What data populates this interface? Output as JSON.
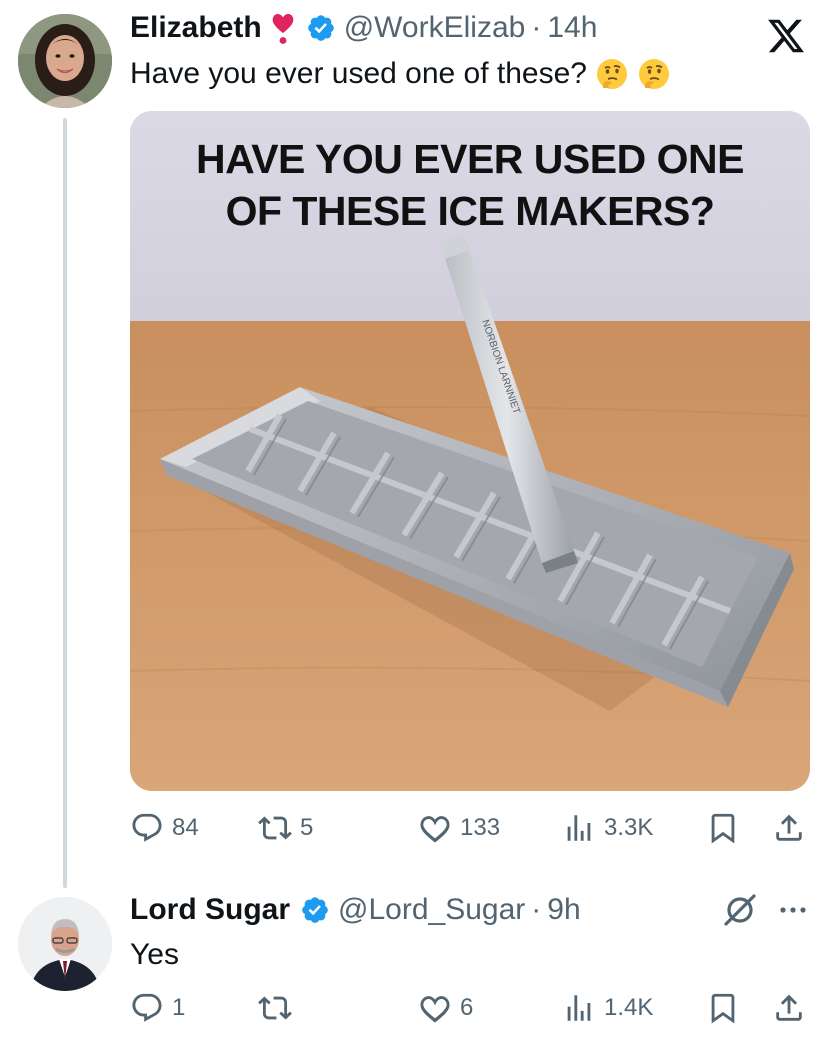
{
  "tweet": {
    "display_name": "Elizabeth",
    "handle": "@WorkElizab",
    "separator": "·",
    "time": "14h",
    "text": "Have you ever used one of these?",
    "emoji": [
      "thinking-face-emoji",
      "thinking-face-emoji"
    ],
    "image_caption_line1": "HAVE YOU EVER USED ONE",
    "image_caption_line2": "OF THESE ICE MAKERS?",
    "tool_engraving": "NORBION LARNNIET",
    "stats": {
      "replies": "84",
      "retweets": "5",
      "likes": "133",
      "views": "3.3K"
    }
  },
  "reply": {
    "display_name": "Lord Sugar",
    "handle": "@Lord_Sugar",
    "separator": "·",
    "time": "9h",
    "text": "Yes",
    "stats": {
      "replies": "1",
      "retweets": "",
      "likes": "6",
      "views": "1.4K"
    }
  },
  "icons": {
    "brand": "x-logo-icon",
    "verified": "verified-badge-icon",
    "heart_badge": "red-heart-exclamation-icon",
    "grok": "grok-icon",
    "more": "more-options-icon"
  },
  "colors": {
    "text": "#0f1419",
    "secondary": "#536471",
    "verified": "#1d9bf0",
    "heart": "#e0245e"
  }
}
